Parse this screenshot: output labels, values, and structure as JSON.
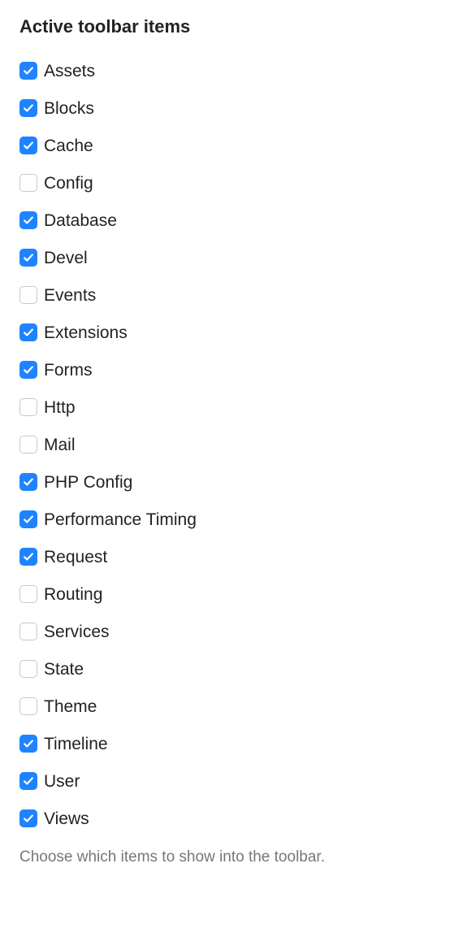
{
  "section": {
    "title": "Active toolbar items",
    "help": "Choose which items to show into the toolbar.",
    "items": [
      {
        "label": "Assets",
        "checked": true
      },
      {
        "label": "Blocks",
        "checked": true
      },
      {
        "label": "Cache",
        "checked": true
      },
      {
        "label": "Config",
        "checked": false
      },
      {
        "label": "Database",
        "checked": true
      },
      {
        "label": "Devel",
        "checked": true
      },
      {
        "label": "Events",
        "checked": false
      },
      {
        "label": "Extensions",
        "checked": true
      },
      {
        "label": "Forms",
        "checked": true
      },
      {
        "label": "Http",
        "checked": false
      },
      {
        "label": "Mail",
        "checked": false
      },
      {
        "label": "PHP Config",
        "checked": true
      },
      {
        "label": "Performance Timing",
        "checked": true
      },
      {
        "label": "Request",
        "checked": true
      },
      {
        "label": "Routing",
        "checked": false
      },
      {
        "label": "Services",
        "checked": false
      },
      {
        "label": "State",
        "checked": false
      },
      {
        "label": "Theme",
        "checked": false
      },
      {
        "label": "Timeline",
        "checked": true
      },
      {
        "label": "User",
        "checked": true
      },
      {
        "label": "Views",
        "checked": true
      }
    ]
  }
}
